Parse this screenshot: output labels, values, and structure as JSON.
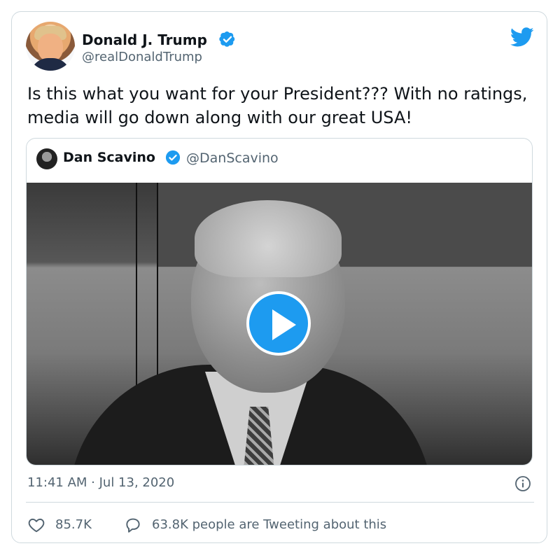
{
  "author": {
    "name": "Donald J. Trump",
    "handle": "@realDonaldTrump",
    "verified_icon": "verified-badge-icon",
    "avatar_desc": "profile-photo"
  },
  "tweet": {
    "text": "Is this what you want for your President??? With no ratings, media will go down along with our great USA!"
  },
  "quoted": {
    "name": "Dan Scavino",
    "handle": "@DanScavino",
    "media": {
      "type": "video",
      "play_icon": "play-icon"
    }
  },
  "meta": {
    "timestamp": "11:41 AM · Jul 13, 2020"
  },
  "stats": {
    "likes": "85.7K",
    "talking": "63.8K people are Tweeting about this"
  },
  "colors": {
    "accent": "#1d9bf0",
    "text_secondary": "#536471",
    "border": "#cfd9de"
  }
}
